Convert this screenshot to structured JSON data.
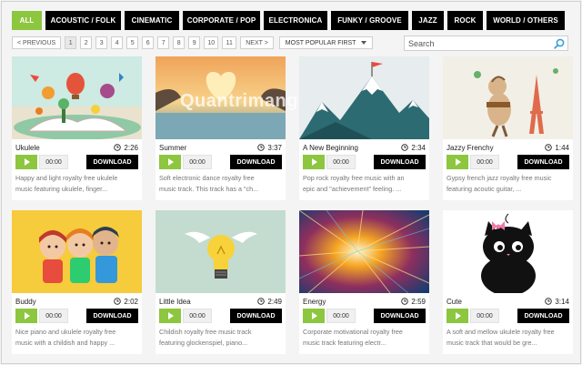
{
  "categories": [
    {
      "label": "ALL",
      "active": true
    },
    {
      "label": "ACOUSTIC / FOLK",
      "active": false
    },
    {
      "label": "CINEMATIC",
      "active": false
    },
    {
      "label": "CORPORATE / POP",
      "active": false
    },
    {
      "label": "ELECTRONICA",
      "active": false
    },
    {
      "label": "FUNKY / GROOVE",
      "active": false
    },
    {
      "label": "JAZZ",
      "active": false
    },
    {
      "label": "ROCK",
      "active": false
    },
    {
      "label": "WORLD / OTHERS",
      "active": false
    }
  ],
  "pagination": {
    "previous_label": "< PREVIOUS",
    "pages": [
      "1",
      "2",
      "3",
      "4",
      "5",
      "6",
      "7",
      "8",
      "9",
      "10",
      "11"
    ],
    "current_page": "1",
    "next_label": "NEXT >",
    "sort_label": "MOST POPULAR FIRST"
  },
  "search": {
    "placeholder": "Search"
  },
  "player": {
    "time_label": "00:00",
    "download_label": "DOWNLOAD"
  },
  "watermark": "Quantrimang",
  "tracks": [
    {
      "title": "Ukulele",
      "duration": "2:26",
      "desc_line1": "Happy and light royalty free ukulele",
      "desc_line2": "music featuring ukulele, finger..."
    },
    {
      "title": "Summer",
      "duration": "3:37",
      "desc_line1": "Soft electronic dance royalty free",
      "desc_line2": "music track. This track has a \"ch..."
    },
    {
      "title": "A New Beginning",
      "duration": "2:34",
      "desc_line1": "Pop rock royalty free music with an",
      "desc_line2": "epic and \"achievement\" feeling. ..."
    },
    {
      "title": "Jazzy Frenchy",
      "duration": "1:44",
      "desc_line1": "Gypsy french jazz royalty free music",
      "desc_line2": "featuring acoutic guitar, ..."
    },
    {
      "title": "Buddy",
      "duration": "2:02",
      "desc_line1": "Nice piano and ukulele royalty free",
      "desc_line2": "music with a childish and happy ..."
    },
    {
      "title": "Little Idea",
      "duration": "2:49",
      "desc_line1": "Childish royalty free music track",
      "desc_line2": "featuring glockenspiel, piano..."
    },
    {
      "title": "Energy",
      "duration": "2:59",
      "desc_line1": "Corporate motivational royalty free",
      "desc_line2": "music track featuring electr..."
    },
    {
      "title": "Cute",
      "duration": "3:14",
      "desc_line1": "A soft and mellow ukulele royalty free",
      "desc_line2": "music track that would be gre..."
    }
  ],
  "colors": {
    "accent_green": "#8dc63f",
    "button_black": "#000000",
    "page_bg": "#f4f4f4"
  }
}
